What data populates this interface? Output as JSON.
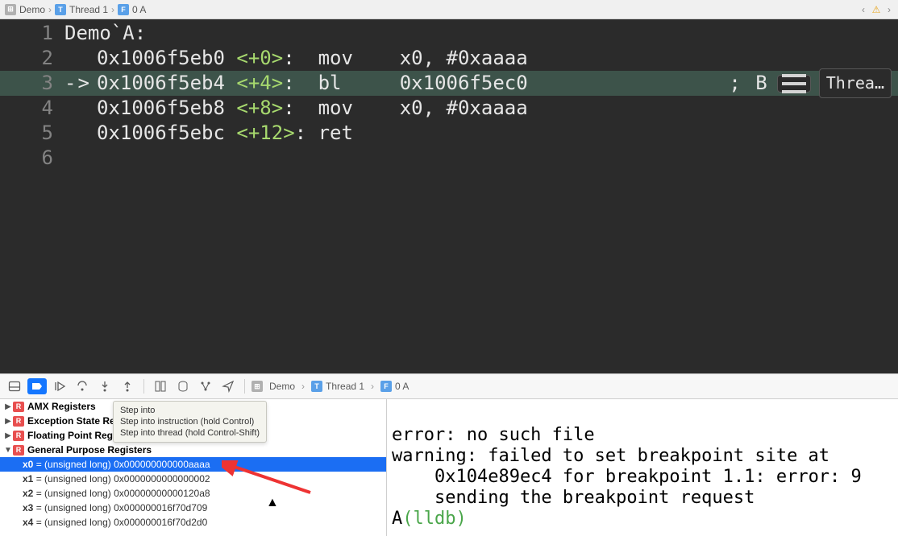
{
  "top_breadcrumb": {
    "items": [
      "Demo",
      "Thread 1",
      "0 A"
    ]
  },
  "editor": {
    "function_label": "Demo`A:",
    "current_line_index": 2,
    "lines": [
      {
        "num": "1",
        "label": true
      },
      {
        "num": "2",
        "addr": "0x1006f5eb0",
        "offset": "<+0>",
        "mnem": "mov",
        "oper": "x0, #0xaaaa"
      },
      {
        "num": "3",
        "addr": "0x1006f5eb4",
        "offset": "<+4>",
        "mnem": "bl",
        "oper": "0x1006f5ec0",
        "arrow": "->",
        "comment": "; B"
      },
      {
        "num": "4",
        "addr": "0x1006f5eb8",
        "offset": "<+8>",
        "mnem": "mov",
        "oper": "x0, #0xaaaa"
      },
      {
        "num": "5",
        "addr": "0x1006f5ebc",
        "offset": "<+12>",
        "mnem": "ret",
        "oper": ""
      },
      {
        "num": "6"
      }
    ],
    "right_button_label": "Threa…"
  },
  "tooltip": {
    "line1": "Step into",
    "line2": "Step into instruction (hold Control)",
    "line3": "Step into thread (hold Control-Shift)"
  },
  "debug_breadcrumb": {
    "items": [
      "Demo",
      "Thread 1",
      "0 A"
    ]
  },
  "variables": {
    "groups": [
      {
        "label": "AMX Registers",
        "expanded": false
      },
      {
        "label": "Exception State Re",
        "expanded": false
      },
      {
        "label": "Floating Point Reg",
        "expanded": false
      },
      {
        "label": "General Purpose Registers",
        "expanded": true
      }
    ],
    "registers": [
      {
        "name": "x0",
        "type": "(unsigned long)",
        "value": "0x000000000000aaaa",
        "selected": true
      },
      {
        "name": "x1",
        "type": "(unsigned long)",
        "value": "0x0000000000000002"
      },
      {
        "name": "x2",
        "type": "(unsigned long)",
        "value": "0x00000000000120a8"
      },
      {
        "name": "x3",
        "type": "(unsigned long)",
        "value": "0x000000016f70d709"
      },
      {
        "name": "x4",
        "type": "(unsigned long)",
        "value": "0x000000016f70d2d0"
      }
    ]
  },
  "console": {
    "err_line": "error: no such file",
    "warn_part1": "warning: failed to set breakpoint site at",
    "warn_part2": "    0x104e89ec4 for breakpoint 1.1: error: 9",
    "warn_part3": "    sending the breakpoint request",
    "prompt_prefix": "A",
    "prompt": "(lldb) "
  }
}
